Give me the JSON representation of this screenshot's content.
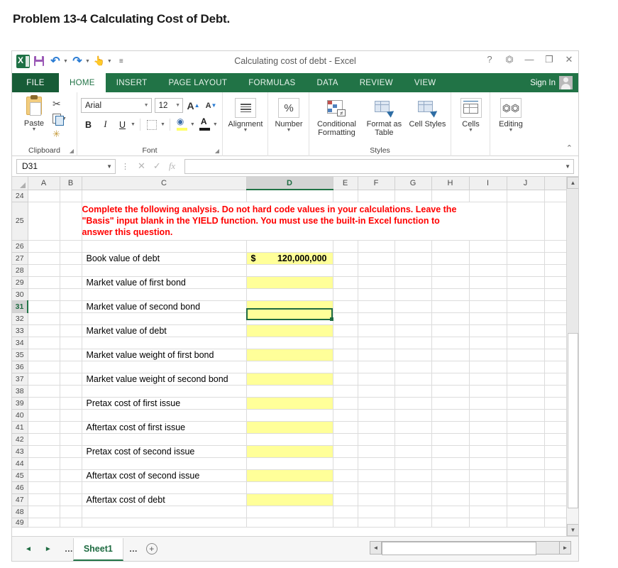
{
  "page": {
    "title": "Problem 13-4 Calculating Cost of Debt."
  },
  "window": {
    "doc_title": "Calculating cost of debt - Excel",
    "signin_label": "Sign In",
    "help_icon": "?",
    "ribbon_display_icon": "⬆",
    "minimize_icon": "—",
    "restore_icon": "❐",
    "close_icon": "✕",
    "qat": {
      "excel_logo": "excel-logo",
      "save": "save-icon",
      "undo": "↶",
      "redo": "↷",
      "touch_mode": "touch-mode-icon",
      "customize": "≡"
    }
  },
  "tabs": [
    {
      "label": "FILE",
      "active": false,
      "file": true
    },
    {
      "label": "HOME",
      "active": true
    },
    {
      "label": "INSERT",
      "active": false
    },
    {
      "label": "PAGE LAYOUT",
      "active": false
    },
    {
      "label": "FORMULAS",
      "active": false
    },
    {
      "label": "DATA",
      "active": false
    },
    {
      "label": "REVIEW",
      "active": false
    },
    {
      "label": "VIEW",
      "active": false
    }
  ],
  "ribbon": {
    "clipboard": {
      "group_label": "Clipboard",
      "paste_label": "Paste",
      "cut_label": "Cut",
      "copy_label": "Copy",
      "format_painter_label": "Format Painter"
    },
    "font": {
      "group_label": "Font",
      "font_name": "Arial",
      "font_size": "12",
      "grow_font": "A",
      "shrink_font": "A",
      "bold": "B",
      "italic": "I",
      "underline": "U"
    },
    "alignment": {
      "group_label": "Alignment",
      "button_label": "Alignment"
    },
    "number": {
      "group_label": "Number",
      "button_label": "Number",
      "icon": "%"
    },
    "styles": {
      "group_label": "Styles",
      "conditional_formatting": "Conditional Formatting",
      "format_as_table": "Format as Table",
      "cell_styles": "Cell Styles"
    },
    "cells": {
      "button_label": "Cells"
    },
    "editing": {
      "button_label": "Editing"
    },
    "collapse_icon": "⌃"
  },
  "formula_bar": {
    "name_box": "D31",
    "cancel_icon": "✕",
    "enter_icon": "✓",
    "insert_function_icon": "fx",
    "formula_value": ""
  },
  "grid": {
    "columns": [
      "A",
      "B",
      "C",
      "D",
      "E",
      "F",
      "G",
      "H",
      "I",
      "J"
    ],
    "selected_column": "D",
    "selected_row": 31,
    "selected_cell": "D31",
    "note_row": 25,
    "note_text": "Complete the following analysis. Do not hard code values in your calculations. Leave the \"Basis\" input blank in the YIELD function. You must use the built-in Excel function to answer this question.",
    "rows": [
      {
        "n": 24,
        "label": "",
        "value": "",
        "filled": false
      },
      {
        "n": 25,
        "label": "",
        "value": "",
        "filled": false,
        "note": true
      },
      {
        "n": 26,
        "label": "",
        "value": "",
        "filled": false
      },
      {
        "n": 27,
        "label": "Book value of debt",
        "value": "120,000,000",
        "currency": "$",
        "filled": true
      },
      {
        "n": 28,
        "label": "",
        "value": "",
        "filled": false
      },
      {
        "n": 29,
        "label": "Market value of first bond",
        "value": "",
        "filled": true
      },
      {
        "n": 30,
        "label": "",
        "value": "",
        "filled": false
      },
      {
        "n": 31,
        "label": "Market value of second bond",
        "value": "",
        "filled": true,
        "selected": true
      },
      {
        "n": 32,
        "label": "",
        "value": "",
        "filled": false
      },
      {
        "n": 33,
        "label": "Market value of debt",
        "value": "",
        "filled": true
      },
      {
        "n": 34,
        "label": "",
        "value": "",
        "filled": false
      },
      {
        "n": 35,
        "label": "Market value weight of first bond",
        "value": "",
        "filled": true
      },
      {
        "n": 36,
        "label": "",
        "value": "",
        "filled": false
      },
      {
        "n": 37,
        "label": "Market value weight of second bond",
        "value": "",
        "filled": true
      },
      {
        "n": 38,
        "label": "",
        "value": "",
        "filled": false
      },
      {
        "n": 39,
        "label": "Pretax cost of first issue",
        "value": "",
        "filled": true
      },
      {
        "n": 40,
        "label": "",
        "value": "",
        "filled": false
      },
      {
        "n": 41,
        "label": "Aftertax cost of first issue",
        "value": "",
        "filled": true
      },
      {
        "n": 42,
        "label": "",
        "value": "",
        "filled": false
      },
      {
        "n": 43,
        "label": "Pretax cost of second issue",
        "value": "",
        "filled": true
      },
      {
        "n": 44,
        "label": "",
        "value": "",
        "filled": false
      },
      {
        "n": 45,
        "label": "Aftertax cost of second issue",
        "value": "",
        "filled": true
      },
      {
        "n": 46,
        "label": "",
        "value": "",
        "filled": false
      },
      {
        "n": 47,
        "label": "Aftertax cost of debt",
        "value": "",
        "filled": true
      },
      {
        "n": 48,
        "label": "",
        "value": "",
        "filled": false
      },
      {
        "n": 49,
        "label": "",
        "value": "",
        "filled": false
      }
    ]
  },
  "sheetbar": {
    "first_icon": "◄",
    "last_icon": "►",
    "left_dots": "…",
    "right_dots": "…",
    "sheet_name": "Sheet1",
    "add_sheet_icon": "+",
    "hscroll_left": "◄",
    "hscroll_right": "►"
  },
  "colors": {
    "excel_green": "#217346",
    "highlight_yellow": "#ffff99",
    "note_red": "#ff0000",
    "selection_green": "#1e6b41"
  }
}
